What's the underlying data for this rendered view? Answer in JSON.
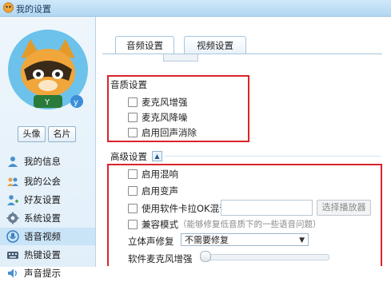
{
  "window": {
    "title": "我的设置"
  },
  "sidebar": {
    "buttons": [
      "头像",
      "名片"
    ],
    "items": [
      {
        "label": "我的信息",
        "icon": "user-info-icon",
        "active": false
      },
      {
        "label": "我的公会",
        "icon": "guild-icon",
        "active": false
      },
      {
        "label": "好友设置",
        "icon": "friend-settings-icon",
        "active": false
      },
      {
        "label": "系统设置",
        "icon": "gear-icon",
        "active": false
      },
      {
        "label": "语音视频",
        "icon": "voice-video-icon",
        "active": true
      },
      {
        "label": "热键设置",
        "icon": "hotkey-icon",
        "active": false
      },
      {
        "label": "声音提示",
        "icon": "sound-icon",
        "active": false
      }
    ]
  },
  "tabs": [
    {
      "label": "音频设置",
      "active": true
    },
    {
      "label": "视频设置",
      "active": false
    }
  ],
  "quality": {
    "title": "音质设置",
    "options": [
      {
        "label": "麦克风增强",
        "checked": false
      },
      {
        "label": "麦克风降噪",
        "checked": false
      },
      {
        "label": "启用回声消除",
        "checked": false
      }
    ]
  },
  "advanced": {
    "title": "高级设置",
    "options": [
      {
        "label": "启用混响",
        "checked": false
      },
      {
        "label": "启用变声",
        "checked": false
      },
      {
        "label": "使用软件卡拉OK混音",
        "checked": false
      },
      {
        "label": "兼容模式",
        "checked": false
      }
    ],
    "compat_note": "（能够修复低音质下的一些语音问题）",
    "player_button": "选择播放器",
    "stereo_label": "立体声修复",
    "stereo_value": "不需要修复",
    "mic_boost_label": "软件麦克风增强"
  },
  "colors": {
    "highlight_box": "#d9242a",
    "active_nav": "#c9e3f7"
  }
}
